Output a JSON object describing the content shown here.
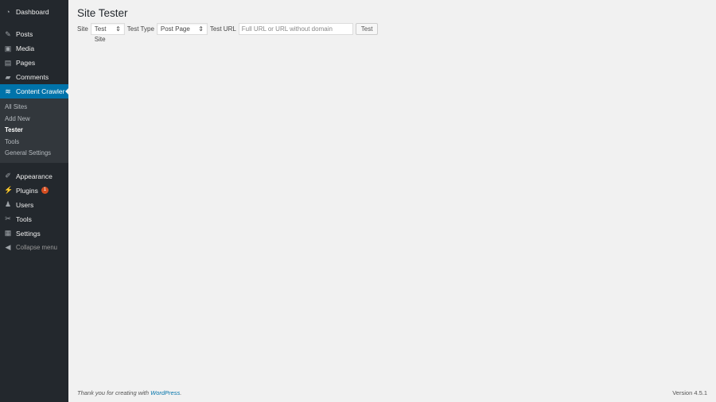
{
  "sidebar": {
    "items_top": [
      {
        "label": "Dashboard",
        "icon": "dashboard-icon",
        "glyph": "◔"
      }
    ],
    "items": [
      {
        "label": "Posts",
        "icon": "pin-icon",
        "glyph": "✎"
      },
      {
        "label": "Media",
        "icon": "media-icon",
        "glyph": "▣"
      },
      {
        "label": "Pages",
        "icon": "pages-icon",
        "glyph": "▤"
      },
      {
        "label": "Comments",
        "icon": "comment-icon",
        "glyph": "▰"
      }
    ],
    "active": {
      "label": "Content Crawler",
      "icon": "crawler-icon",
      "glyph": "≋"
    },
    "submenu": [
      "All Sites",
      "Add New",
      "Tester",
      "Tools",
      "General Settings"
    ],
    "items_bottom": [
      {
        "label": "Appearance",
        "icon": "brush-icon",
        "glyph": "✐"
      },
      {
        "label": "Plugins",
        "icon": "plugin-icon",
        "glyph": "⚡",
        "badge": "1"
      },
      {
        "label": "Users",
        "icon": "user-icon",
        "glyph": "♟"
      },
      {
        "label": "Tools",
        "icon": "wrench-icon",
        "glyph": "✂"
      },
      {
        "label": "Settings",
        "icon": "settings-icon",
        "glyph": "▦"
      }
    ],
    "collapse": "Collapse menu"
  },
  "page": {
    "title": "Site Tester",
    "site_label": "Site",
    "site_value": "Test Site",
    "type_label": "Test Type",
    "type_value": "Post Page",
    "url_label": "Test URL",
    "url_placeholder": "Full URL or URL without domain",
    "test_button": "Test"
  },
  "footer": {
    "thanks": "Thank you for creating with ",
    "link": "WordPress",
    "period": ".",
    "version": "Version 4.5.1"
  }
}
